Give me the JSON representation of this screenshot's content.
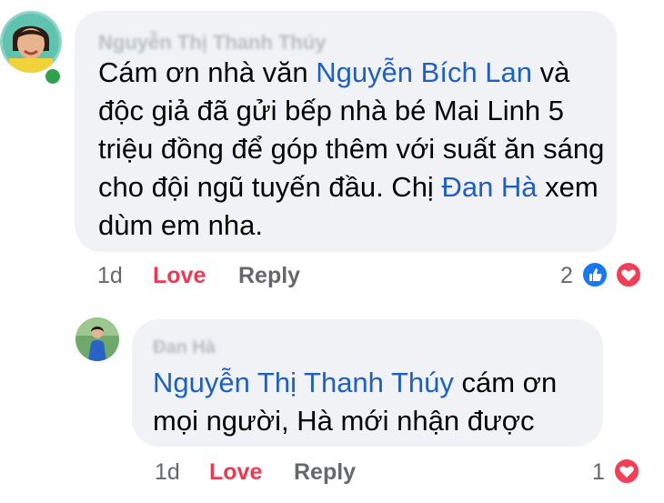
{
  "comment": {
    "author": "Nguyễn Thị Thanh Thúy",
    "text_1": "Cám ơn nhà văn ",
    "mention_1": "Nguyễn Bích Lan",
    "text_2": " và độc giả đã gửi bếp nhà bé Mai Linh 5 triệu đồng để góp thêm với suất ăn sáng cho đội ngũ tuyến đầu. Chị ",
    "mention_2": "Đan Hà",
    "text_3": " xem dùm em nha.",
    "time": "1d",
    "love_label": "Love",
    "reply_label": "Reply",
    "reaction_count": "2",
    "reactions": [
      "like-icon",
      "love-icon"
    ]
  },
  "reply": {
    "author": "Đan Hà",
    "mention": "Nguyễn Thị Thanh Thúy",
    "text": " cám ơn mọi người, Hà mới nhận được",
    "time": "1d",
    "love_label": "Love",
    "reply_label": "Reply",
    "reaction_count": "1",
    "reactions": [
      "love-icon"
    ]
  },
  "colors": {
    "bubble": "#f0f2f5",
    "mention": "#1f5fbf",
    "love": "#e83a52",
    "like": "#1877f2",
    "online": "#31a24c",
    "muted": "#65676b"
  }
}
